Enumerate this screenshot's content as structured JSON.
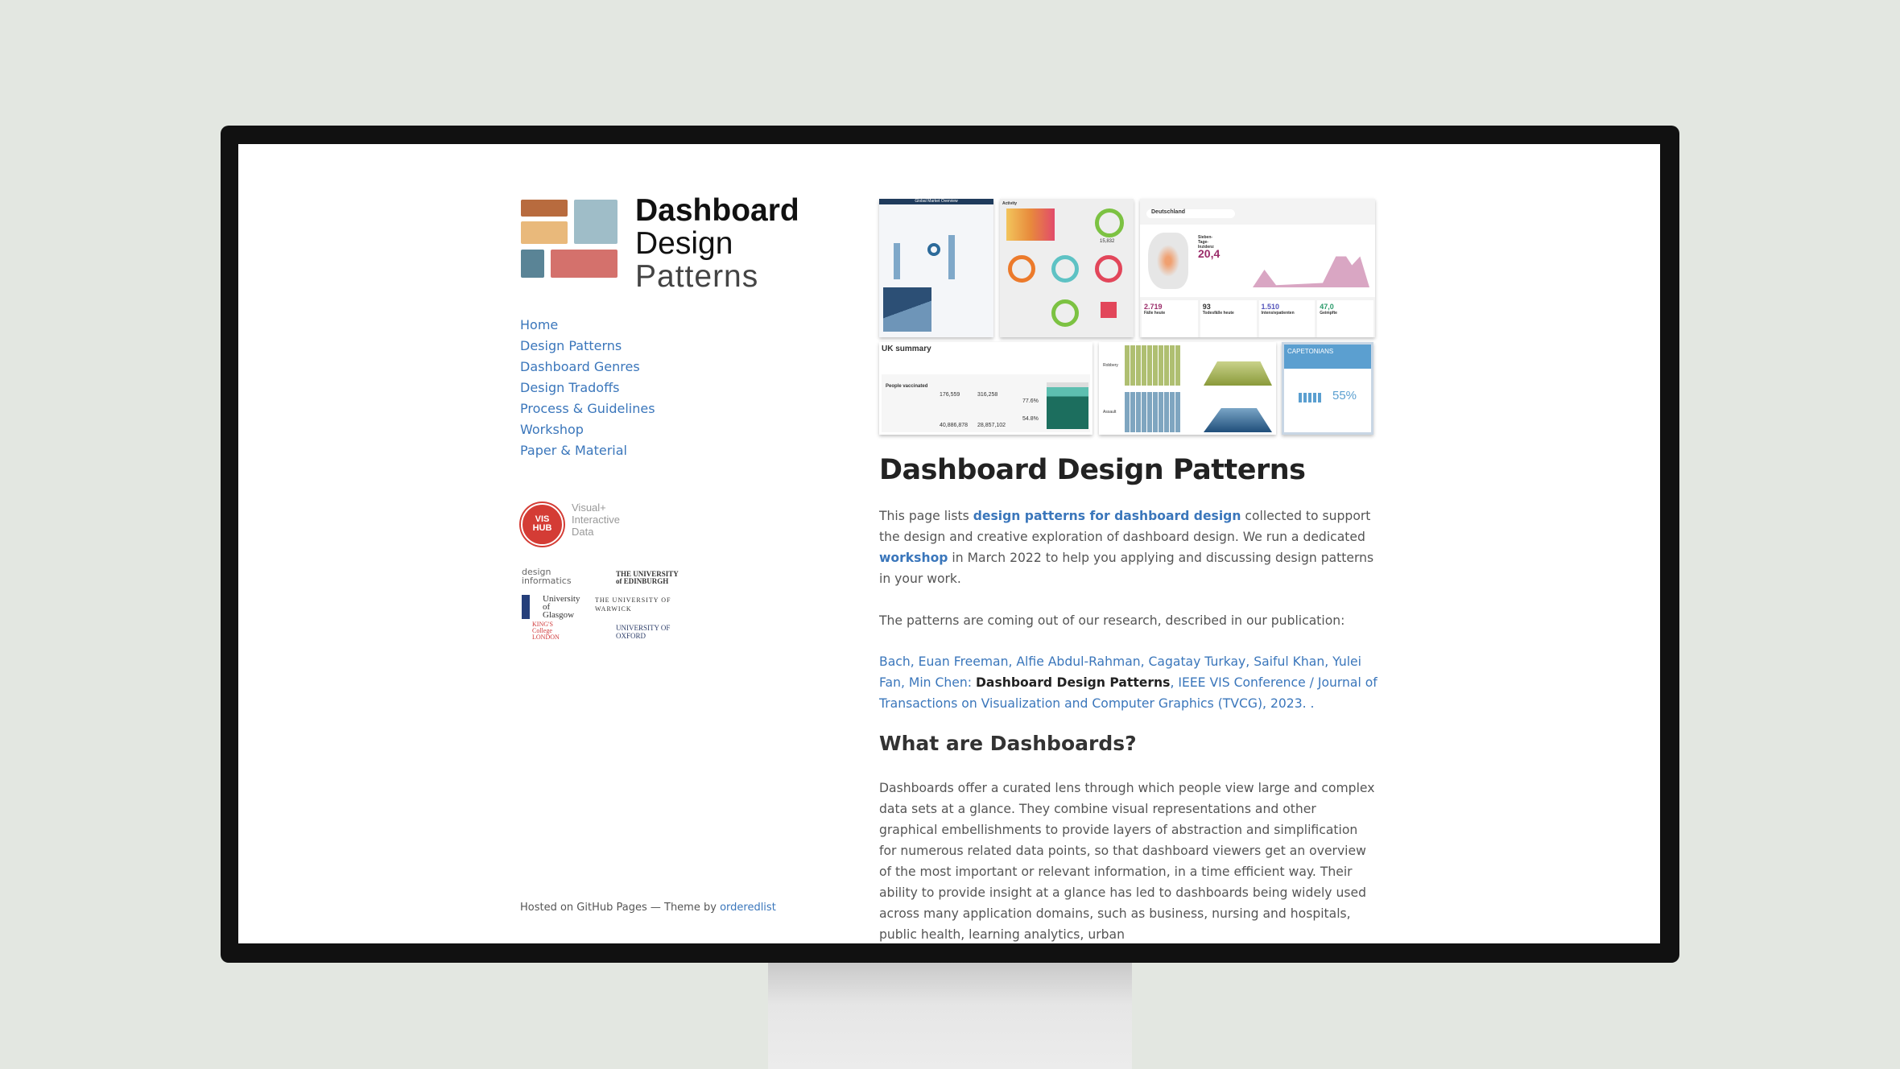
{
  "brand": {
    "line1": "Dashboard",
    "line2": "Design",
    "line3": "Patterns",
    "colors": [
      "#b86b3e",
      "#e9b97b",
      "#9fbdc8",
      "#5a8496",
      "#d4716c"
    ]
  },
  "nav": [
    {
      "label": "Home"
    },
    {
      "label": "Design Patterns"
    },
    {
      "label": "Dashboard Genres"
    },
    {
      "label": "Design Tradoffs"
    },
    {
      "label": "Process & Guidelines"
    },
    {
      "label": "Workshop"
    },
    {
      "label": "Paper & Material"
    }
  ],
  "partners": {
    "vishub_top": "VIS",
    "vishub_bottom": "HUB",
    "vishub_text": [
      "Visual+",
      "Interactive",
      "Data"
    ],
    "logos": [
      "design informatics",
      "THE UNIVERSITY of EDINBURGH",
      "University of Glasgow",
      "THE UNIVERSITY OF WARWICK",
      "KING'S College LONDON",
      "UNIVERSITY OF OXFORD"
    ]
  },
  "footer": {
    "text": "Hosted on GitHub Pages — Theme by ",
    "link": "orderedlist"
  },
  "collage": {
    "p1_title": "Global Market Overview",
    "p2_title": "Activity",
    "p2_value": "15,832",
    "p3_search": "Deutschland",
    "p3_label": "Sieben-Tage-Inzidenz",
    "p3_value": "20,4",
    "p3_kpis": [
      {
        "value": "2.719",
        "label": "Fälle heute"
      },
      {
        "value": "93",
        "label": "Todesfälle heute"
      },
      {
        "value": "1.510",
        "label": "Intensivpatienten"
      },
      {
        "value": "47,0",
        "label": "Geimpfte"
      }
    ],
    "p4_title": "UK summary",
    "p4_label": "People vaccinated",
    "p4_values": [
      "176,559",
      "316,258",
      "40,886,878",
      "28,857,102",
      "77.6%",
      "54.8%"
    ],
    "p5_labels": [
      "Robbery",
      "Assault"
    ],
    "p6_title": "CAPETONIANS",
    "p6_value": "55%"
  },
  "main": {
    "title": "Dashboard Design Patterns",
    "intro": {
      "t1": "This page lists ",
      "l1": "design patterns for dashboard design",
      "t2": " collected to support the design and creative exploration of dashboard design. We run a dedicated ",
      "l2": "workshop",
      "t3": " in March 2022 to help you applying and discussing design patterns in your work."
    },
    "pub_intro": "The patterns are coming out of our research, described in our publication:",
    "citation": {
      "authors": "Bach, Euan Freeman, Alfie Abdul-Rahman, Cagatay Turkay, Saiful Khan, Yulei Fan, Min Chen: ",
      "title": "Dashboard Design Patterns",
      "venue": ", IEEE VIS Conference / Journal of Transactions on Visualization and Computer Graphics (TVCG), 2023. ."
    },
    "h2": "What are Dashboards?",
    "body": "Dashboards offer a curated lens through which people view large and complex data sets at a glance. They combine visual representations and other graphical embellishments to provide layers of abstraction and simplification for numerous related data points, so that dashboard viewers get an overview of the most important or relevant information, in a time efficient way. Their ability to provide insight at a glance has led to dashboards being widely used across many application domains, such as business, nursing and hospitals, public health, learning analytics, urban"
  }
}
